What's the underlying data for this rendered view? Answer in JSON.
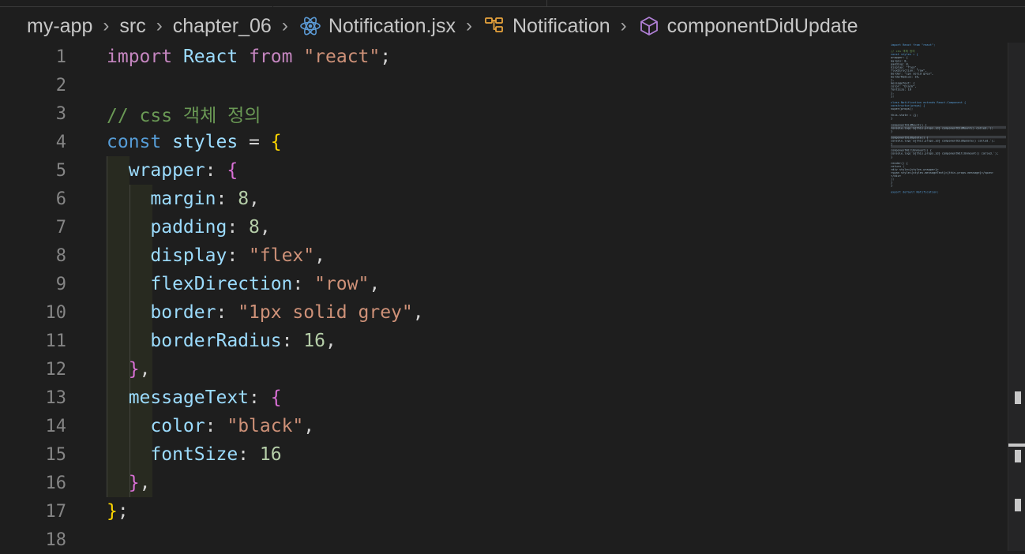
{
  "breadcrumb": [
    {
      "label": "my-app",
      "icon": ""
    },
    {
      "label": "src",
      "icon": ""
    },
    {
      "label": "chapter_06",
      "icon": ""
    },
    {
      "label": "Notification.jsx",
      "icon": "react-icon"
    },
    {
      "label": "Notification",
      "icon": "class-icon"
    },
    {
      "label": "componentDidUpdate",
      "icon": "method-cube-icon"
    }
  ],
  "colors": {
    "background": "#1e1e1e",
    "keyword_purple": "#c586c0",
    "storage_blue": "#569cd6",
    "identifier": "#9cdcfe",
    "string": "#ce9178",
    "number": "#b5cea8",
    "comment": "#6a9955",
    "bracket_gold": "#ffd700",
    "bracket_orchid": "#da70d6",
    "line_number": "#858585",
    "react_icon": "#5c9bd6",
    "class_icon": "#e8a33c",
    "method_icon": "#b180d7"
  },
  "editor": {
    "lines": [
      {
        "n": "1",
        "tokens": [
          [
            "kw",
            "import"
          ],
          [
            "pl",
            " "
          ],
          [
            "id",
            "React"
          ],
          [
            "pl",
            " "
          ],
          [
            "kw",
            "from"
          ],
          [
            "pl",
            " "
          ],
          [
            "str",
            "\"react\""
          ],
          [
            "pl",
            ";"
          ]
        ]
      },
      {
        "n": "2",
        "tokens": []
      },
      {
        "n": "3",
        "tokens": [
          [
            "com",
            "// css 객체 정의"
          ]
        ]
      },
      {
        "n": "4",
        "tokens": [
          [
            "st",
            "const"
          ],
          [
            "pl",
            " "
          ],
          [
            "id",
            "styles"
          ],
          [
            "pl",
            " = "
          ],
          [
            "b1",
            "{"
          ]
        ]
      },
      {
        "n": "5",
        "tokens": [
          [
            "pl",
            "  "
          ],
          [
            "id",
            "wrapper"
          ],
          [
            "pl",
            ": "
          ],
          [
            "b2",
            "{"
          ]
        ]
      },
      {
        "n": "6",
        "tokens": [
          [
            "pl",
            "    "
          ],
          [
            "id",
            "margin"
          ],
          [
            "pl",
            ": "
          ],
          [
            "num",
            "8"
          ],
          [
            "pl",
            ","
          ]
        ]
      },
      {
        "n": "7",
        "tokens": [
          [
            "pl",
            "    "
          ],
          [
            "id",
            "padding"
          ],
          [
            "pl",
            ": "
          ],
          [
            "num",
            "8"
          ],
          [
            "pl",
            ","
          ]
        ]
      },
      {
        "n": "8",
        "tokens": [
          [
            "pl",
            "    "
          ],
          [
            "id",
            "display"
          ],
          [
            "pl",
            ": "
          ],
          [
            "str",
            "\"flex\""
          ],
          [
            "pl",
            ","
          ]
        ]
      },
      {
        "n": "9",
        "tokens": [
          [
            "pl",
            "    "
          ],
          [
            "id",
            "flexDirection"
          ],
          [
            "pl",
            ": "
          ],
          [
            "str",
            "\"row\""
          ],
          [
            "pl",
            ","
          ]
        ]
      },
      {
        "n": "10",
        "tokens": [
          [
            "pl",
            "    "
          ],
          [
            "id",
            "border"
          ],
          [
            "pl",
            ": "
          ],
          [
            "str",
            "\"1px solid grey\""
          ],
          [
            "pl",
            ","
          ]
        ]
      },
      {
        "n": "11",
        "tokens": [
          [
            "pl",
            "    "
          ],
          [
            "id",
            "borderRadius"
          ],
          [
            "pl",
            ": "
          ],
          [
            "num",
            "16"
          ],
          [
            "pl",
            ","
          ]
        ]
      },
      {
        "n": "12",
        "tokens": [
          [
            "pl",
            "  "
          ],
          [
            "b2",
            "}"
          ],
          [
            "pl",
            ","
          ]
        ]
      },
      {
        "n": "13",
        "tokens": [
          [
            "pl",
            "  "
          ],
          [
            "id",
            "messageText"
          ],
          [
            "pl",
            ": "
          ],
          [
            "b2",
            "{"
          ]
        ]
      },
      {
        "n": "14",
        "tokens": [
          [
            "pl",
            "    "
          ],
          [
            "id",
            "color"
          ],
          [
            "pl",
            ": "
          ],
          [
            "str",
            "\"black\""
          ],
          [
            "pl",
            ","
          ]
        ]
      },
      {
        "n": "15",
        "tokens": [
          [
            "pl",
            "    "
          ],
          [
            "id",
            "fontSize"
          ],
          [
            "pl",
            ": "
          ],
          [
            "num",
            "16"
          ]
        ]
      },
      {
        "n": "16",
        "tokens": [
          [
            "pl",
            "  "
          ],
          [
            "b2",
            "}"
          ],
          [
            "pl",
            ","
          ]
        ]
      },
      {
        "n": "17",
        "tokens": [
          [
            "b1",
            "}"
          ],
          [
            "pl",
            ";"
          ]
        ]
      },
      {
        "n": "18",
        "tokens": []
      }
    ]
  },
  "minimap": {
    "lines": [
      "import React from \"react\";",
      "",
      "// css 객체 정의",
      "const styles = {",
      "  wrapper: {",
      "    margin: 8,",
      "    padding: 8,",
      "    display: \"flex\",",
      "    flexDirection: \"row\",",
      "    border: \"1px solid grey\",",
      "    borderRadius: 16,",
      "  },",
      "  messageText: {",
      "    color: \"black\",",
      "    fontSize: 16",
      "  },",
      "};",
      "",
      "class Notification extends React.Component {",
      "  constructor(props) {",
      "    super(props);",
      "",
      "    this.state = {};",
      "  }",
      "",
      "  componentDidMount() {",
      "    console.log(`${this.props.id} componentDidMount() called.`);",
      "  }",
      "",
      "  componentDidUpdate() {",
      "    console.log(`${this.props.id} componentDidUpdate() called.`);",
      "  }",
      "",
      "  componentWillUnmount() {",
      "    console.log(`${this.props.id} componentWillUnmount() called.`);",
      "  }",
      "",
      "  render() {",
      "    return (",
      "      <div style={styles.wrapper}>",
      "        <span style={styles.messageText}>{this.props.message}</span>",
      "      </div>",
      "    );",
      "  }",
      "}",
      "",
      "export default Notification;"
    ]
  }
}
